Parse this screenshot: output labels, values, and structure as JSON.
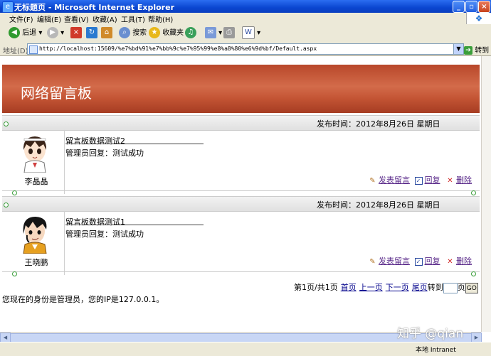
{
  "window": {
    "title": "无标题页 - Microsoft Internet Explorer"
  },
  "menu": [
    "文件(F)",
    "编辑(E)",
    "查看(V)",
    "收藏(A)",
    "工具(T)",
    "帮助(H)"
  ],
  "toolbar": {
    "back": "后退",
    "search": "搜索",
    "favorites": "收藏夹"
  },
  "address": {
    "label": "地址(D)",
    "url": "http://localhost:15609/%e7%bd%91%e7%bb%9c%e7%95%99%e8%a8%80%e6%9d%bf/Default.aspx",
    "go": "转到"
  },
  "page": {
    "banner": "网络留言板",
    "messages": [
      {
        "datetime": "发布时间：2012年8月26日  星期日",
        "user": "李晶晶",
        "title": "留言板数据测试2",
        "reply": "管理员回复：测试成功",
        "actions": {
          "post": "发表留言",
          "reply": "回复",
          "delete": "删除"
        }
      },
      {
        "datetime": "发布时间：2012年8月26日  星期日",
        "user": "王晓鹏",
        "title": "留言板数据测试1",
        "reply": "管理员回复：测试成功",
        "actions": {
          "post": "发表留言",
          "reply": "回复",
          "delete": "删除"
        }
      }
    ],
    "pager": {
      "info": "第1页/共1页",
      "first": "首页",
      "prev": "上一页",
      "next": "下一页",
      "last": "尾页",
      "goto": "转到",
      "page_suffix": "页",
      "go_btn": "GO"
    },
    "identity": "您现在的身份是管理员，您的IP是127.0.0.1。"
  },
  "status": {
    "zone": "本地 Intranet"
  },
  "watermark": "知乎 @qian",
  "colors": {
    "titlebar": "#0a46d0",
    "banner": "#c35434",
    "link": "#5a2a8a"
  }
}
